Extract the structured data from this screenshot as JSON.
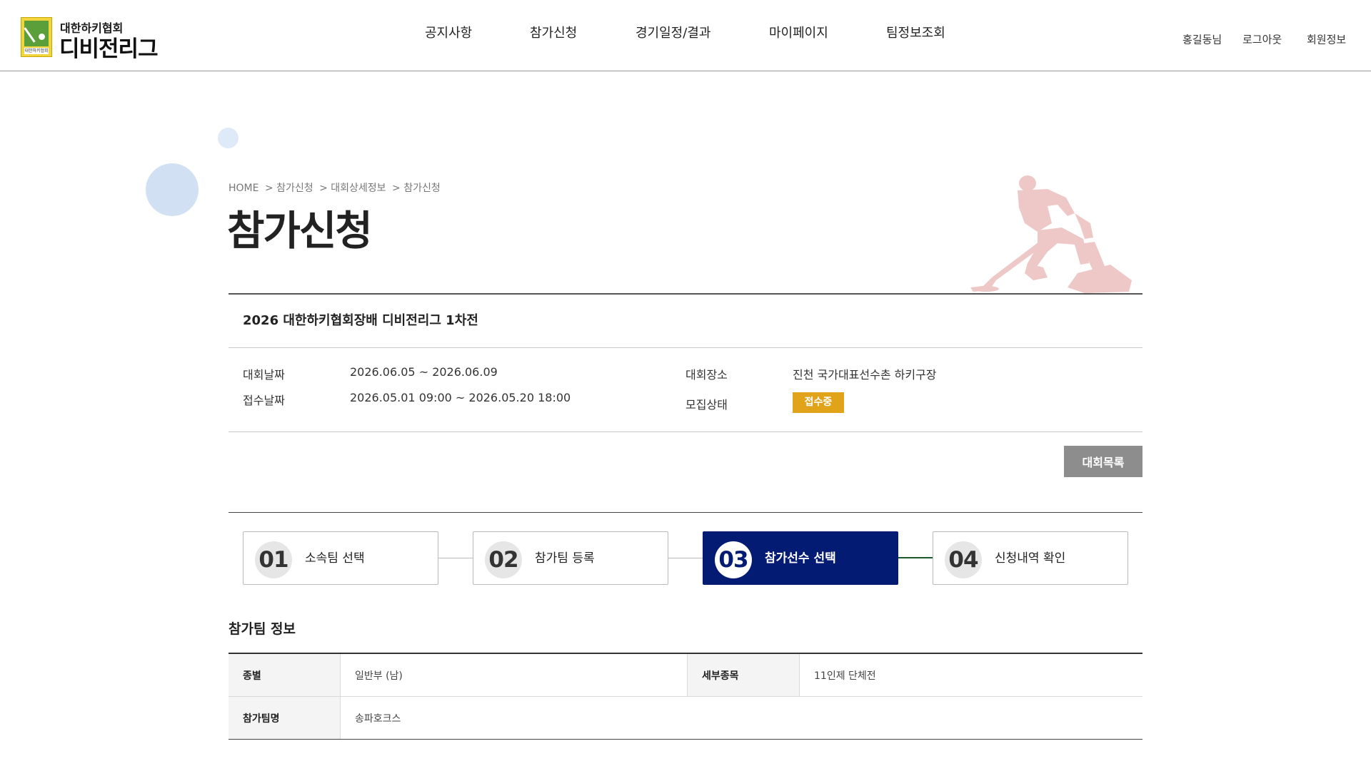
{
  "header": {
    "logo_small": "대한하키협회",
    "logo_main": "디비전리그",
    "logo_badge_text": "대한하키협회",
    "nav": [
      "공지사항",
      "참가신청",
      "경기일정/결과",
      "마이페이지",
      "팀정보조회"
    ],
    "util": [
      "홍길동님",
      "로그아웃",
      "회원정보"
    ]
  },
  "breadcrumb": [
    "HOME",
    "> 참가신청",
    "> 대회상세정보",
    "> 참가신청"
  ],
  "page_title": "참가신청",
  "event": {
    "name": "2026 대한하키협회장배 디비전리그 1차전",
    "date_label": "대회날짜",
    "date_value": "2026.06.05 ~ 2026.06.09",
    "receipt_label": "접수날짜",
    "receipt_value": "2026.05.01 09:00 ~ 2026.05.20 18:00",
    "venue_label": "대회장소",
    "venue_value": "진천 국가대표선수촌 하키구장",
    "status_label": "모집상태",
    "status_value": "접수중",
    "status_color": "#e0a31a"
  },
  "list_button": "대회목록",
  "steps": [
    {
      "num": "01",
      "label": "소속팀 선택",
      "active": false
    },
    {
      "num": "02",
      "label": "참가팀 등록",
      "active": false
    },
    {
      "num": "03",
      "label": "참가선수 선택",
      "active": true
    },
    {
      "num": "04",
      "label": "신청내역 확인",
      "active": false
    }
  ],
  "active_color": "#041b74",
  "team_section": {
    "title": "참가팀 정보",
    "rows": [
      {
        "label1": "종별",
        "value1": "일반부 (남)",
        "label2": "세부종목",
        "value2": "11인제 단체전"
      },
      {
        "label1": "참가팀명",
        "value1": "송파호크스"
      }
    ]
  }
}
